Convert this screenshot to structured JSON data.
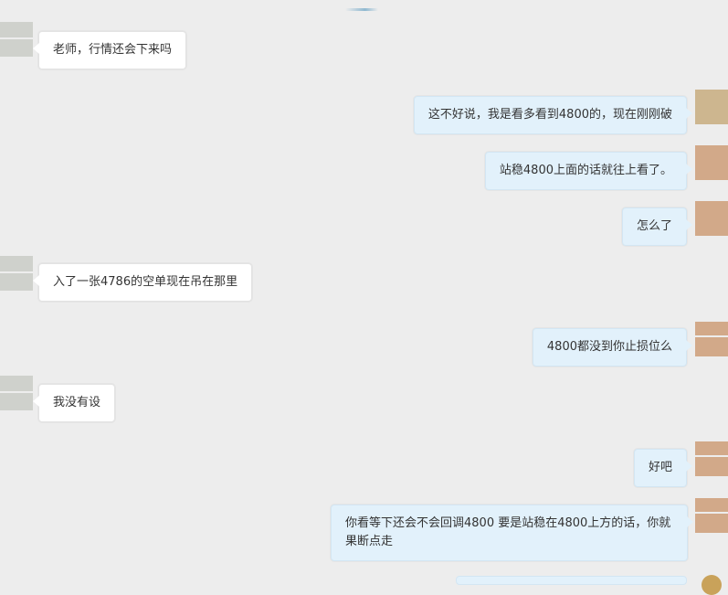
{
  "colors": {
    "background": "#ededed",
    "incoming_bubble": "#ffffff",
    "outgoing_bubble": "#e2f1fb",
    "contact_avatar": "#cfd1cc",
    "self_avatar": "#d2a989"
  },
  "messages": [
    {
      "side": "in",
      "text": "老师，行情还会下来吗"
    },
    {
      "side": "out",
      "text": "这不好说，我是看多看到4800的，现在刚刚破"
    },
    {
      "side": "out",
      "text": "站稳4800上面的话就往上看了。"
    },
    {
      "side": "out",
      "text": "怎么了"
    },
    {
      "side": "in",
      "text": "入了一张4786的空单现在吊在那里"
    },
    {
      "side": "out",
      "text": "4800都没到你止损位么"
    },
    {
      "side": "in",
      "text": "我没有设"
    },
    {
      "side": "out",
      "text": "好吧"
    },
    {
      "side": "out",
      "text": "你看等下还会不会回调4800 要是站稳在4800上方的话，你就果断点走"
    }
  ]
}
